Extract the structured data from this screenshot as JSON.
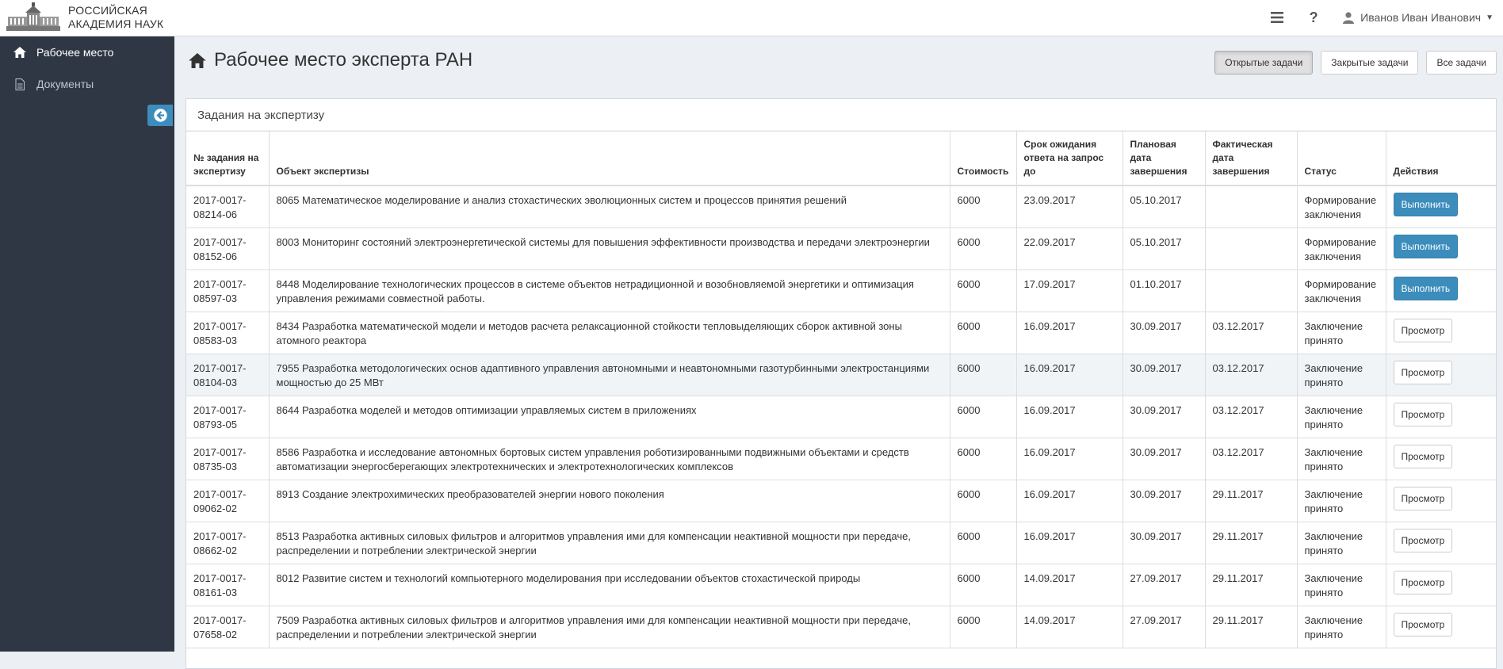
{
  "header": {
    "logo_line1": "РОССИЙСКАЯ",
    "logo_line2": "АКАДЕМИЯ НАУК",
    "user_name": "Иванов Иван Иванович"
  },
  "sidebar": {
    "items": [
      {
        "label": "Рабочее место",
        "icon": "home-icon"
      },
      {
        "label": "Документы",
        "icon": "document-icon"
      }
    ]
  },
  "page": {
    "title": "Рабочее место эксперта РАН",
    "filters": [
      "Открытые задачи",
      "Закрытые задачи",
      "Все задачи"
    ],
    "active_filter": "Открытые задачи"
  },
  "table": {
    "box_title": "Задания на экспертизу",
    "headers": [
      "№ задания на экспертизу",
      "Объект экспертизы",
      "Стоимость",
      "Срок ожидания ответа на запрос до",
      "Плановая дата завершения",
      "Фактическая дата завершения",
      "Статус",
      "Действия"
    ],
    "rows": [
      {
        "id": "2017-0017-08214-06",
        "object": "8065 Математическое моделирование и анализ стохастических эволюционных систем и процессов принятия решений",
        "cost": "6000",
        "deadline": "23.09.2017",
        "planned": "05.10.2017",
        "actual": "",
        "status": "Формирование заключения",
        "action": "Выполнить",
        "action_type": "primary"
      },
      {
        "id": "2017-0017-08152-06",
        "object": "8003 Мониторинг состояний электроэнергетической системы для повышения эффективности производства и передачи электроэнергии",
        "cost": "6000",
        "deadline": "22.09.2017",
        "planned": "05.10.2017",
        "actual": "",
        "status": "Формирование заключения",
        "action": "Выполнить",
        "action_type": "primary"
      },
      {
        "id": "2017-0017-08597-03",
        "object": "8448 Моделирование технологических процессов в системе объектов нетрадиционной и возобновляемой энергетики и оптимизация управления режимами совместной работы.",
        "cost": "6000",
        "deadline": "17.09.2017",
        "planned": "01.10.2017",
        "actual": "",
        "status": "Формирование заключения",
        "action": "Выполнить",
        "action_type": "primary"
      },
      {
        "id": "2017-0017-08583-03",
        "object": "8434 Разработка математической модели и методов расчета релаксационной стойкости тепловыделяющих сборок активной зоны атомного реактора",
        "cost": "6000",
        "deadline": "16.09.2017",
        "planned": "30.09.2017",
        "actual": "03.12.2017",
        "status": "Заключение принято",
        "action": "Просмотр",
        "action_type": "default"
      },
      {
        "id": "2017-0017-08104-03",
        "object": "7955 Разработка методологических основ адаптивного управления автономными и неавтономными газотурбинными электростанциями мощностью до 25 МВт",
        "cost": "6000",
        "deadline": "16.09.2017",
        "planned": "30.09.2017",
        "actual": "03.12.2017",
        "status": "Заключение принято",
        "action": "Просмотр",
        "action_type": "default",
        "highlight": true
      },
      {
        "id": "2017-0017-08793-05",
        "object": "8644 Разработка моделей и методов оптимизации управляемых систем в приложениях",
        "cost": "6000",
        "deadline": "16.09.2017",
        "planned": "30.09.2017",
        "actual": "03.12.2017",
        "status": "Заключение принято",
        "action": "Просмотр",
        "action_type": "default"
      },
      {
        "id": "2017-0017-08735-03",
        "object": "8586 Разработка и исследование автономных бортовых систем управления роботизированными подвижными объектами и средств автоматизации энергосберегающих электротехнических и электротехнологических комплексов",
        "cost": "6000",
        "deadline": "16.09.2017",
        "planned": "30.09.2017",
        "actual": "03.12.2017",
        "status": "Заключение принято",
        "action": "Просмотр",
        "action_type": "default"
      },
      {
        "id": "2017-0017-09062-02",
        "object": "8913 Создание электрохимических преобразователей энергии нового поколения",
        "cost": "6000",
        "deadline": "16.09.2017",
        "planned": "30.09.2017",
        "actual": "29.11.2017",
        "status": "Заключение принято",
        "action": "Просмотр",
        "action_type": "default"
      },
      {
        "id": "2017-0017-08662-02",
        "object": "8513 Разработка активных силовых фильтров и алгоритмов управления ими для компенсации неактивной мощности при передаче, распределении и потреблении электрической энергии",
        "cost": "6000",
        "deadline": "16.09.2017",
        "planned": "30.09.2017",
        "actual": "29.11.2017",
        "status": "Заключение принято",
        "action": "Просмотр",
        "action_type": "default"
      },
      {
        "id": "2017-0017-08161-03",
        "object": "8012 Развитие систем и технологий компьютерного моделирования при исследовании объектов стохастической природы",
        "cost": "6000",
        "deadline": "14.09.2017",
        "planned": "27.09.2017",
        "actual": "29.11.2017",
        "status": "Заключение принято",
        "action": "Просмотр",
        "action_type": "default"
      },
      {
        "id": "2017-0017-07658-02",
        "object": "7509 Разработка активных силовых фильтров и алгоритмов управления ими для компенсации неактивной мощности при передаче, распределении и потреблении электрической энергии",
        "cost": "6000",
        "deadline": "14.09.2017",
        "planned": "27.09.2017",
        "actual": "29.11.2017",
        "status": "Заключение принято",
        "action": "Просмотр",
        "action_type": "default"
      }
    ]
  }
}
